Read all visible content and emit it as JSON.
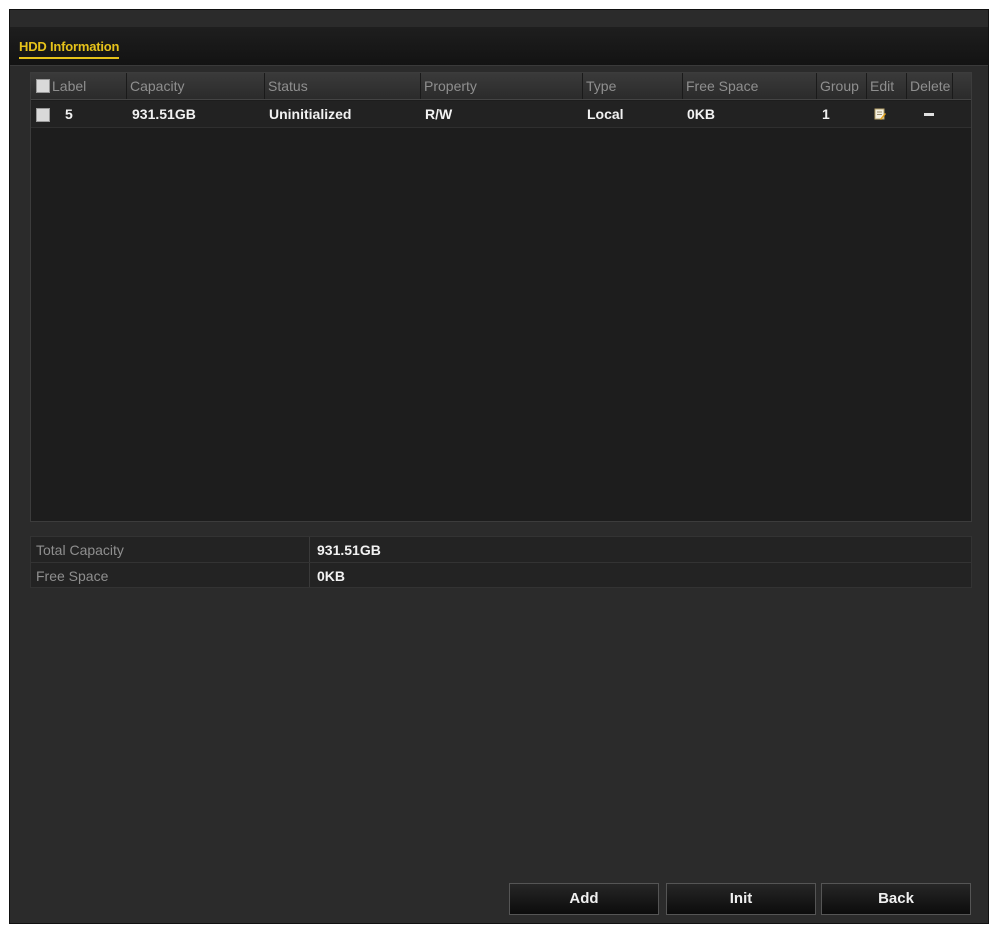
{
  "window": {
    "title": "HDD Information"
  },
  "table": {
    "columns": {
      "label": "Label",
      "capacity": "Capacity",
      "status": "Status",
      "property": "Property",
      "type": "Type",
      "free_space": "Free Space",
      "group": "Group",
      "edit": "Edit",
      "delete": "Delete"
    },
    "rows": [
      {
        "label": "5",
        "capacity": "931.51GB",
        "status": "Uninitialized",
        "property": "R/W",
        "type": "Local",
        "free_space": "0KB",
        "group": "1",
        "edit_icon": "edit-icon",
        "delete_icon": "minus-icon"
      }
    ]
  },
  "summary": {
    "total_capacity_label": "Total Capacity",
    "total_capacity_value": "931.51GB",
    "free_space_label": "Free Space",
    "free_space_value": "0KB"
  },
  "buttons": {
    "add": "Add",
    "init": "Init",
    "back": "Back"
  },
  "colors": {
    "accent": "#e6c21a",
    "panel_bg": "#2b2b2b"
  }
}
